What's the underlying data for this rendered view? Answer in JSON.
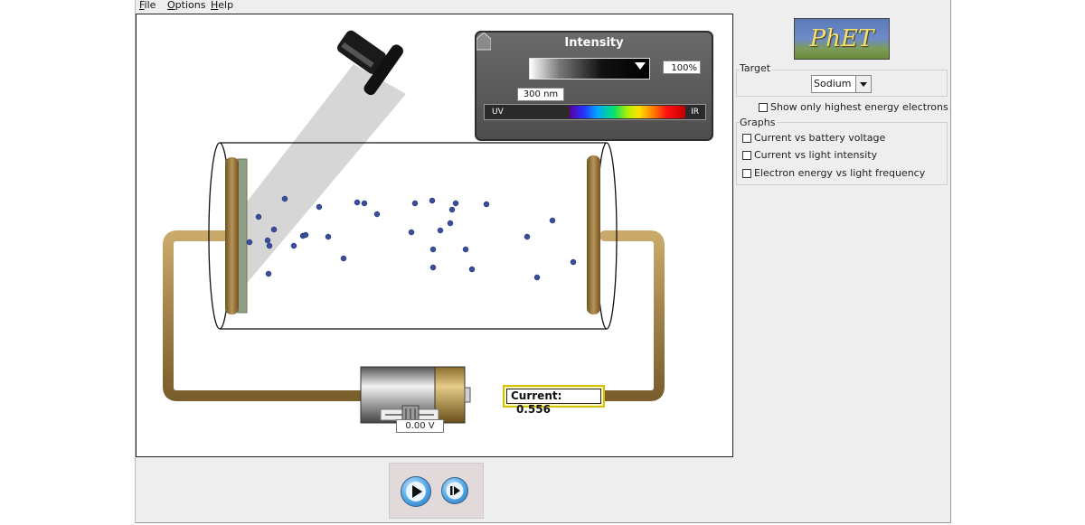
{
  "menu": {
    "file": "File",
    "options": "Options",
    "help": "Help"
  },
  "intensity_panel": {
    "title": "Intensity",
    "intensity_value": "100%",
    "intensity_fraction": 1.0,
    "wavelength_value": "300 nm",
    "uv_label": "UV",
    "ir_label": "IR"
  },
  "circuit": {
    "current_label": "Current:",
    "current_value": "0.556",
    "battery_voltage": "0.00 V"
  },
  "right_panel": {
    "logo_text": "PhET",
    "target_label": "Target",
    "target_value": "Sodium",
    "show_highest_label": "Show only highest energy electrons",
    "graphs_label": "Graphs",
    "graph_options": [
      {
        "label": "Current vs battery voltage",
        "checked": false
      },
      {
        "label": "Current vs light intensity",
        "checked": false
      },
      {
        "label": "Electron energy vs light frequency",
        "checked": false
      }
    ]
  },
  "colors": {
    "wire": "#a0824a",
    "electron": "#3b4e9e",
    "plate": "#8b6a30",
    "light_beam": "#d6d6d6"
  }
}
